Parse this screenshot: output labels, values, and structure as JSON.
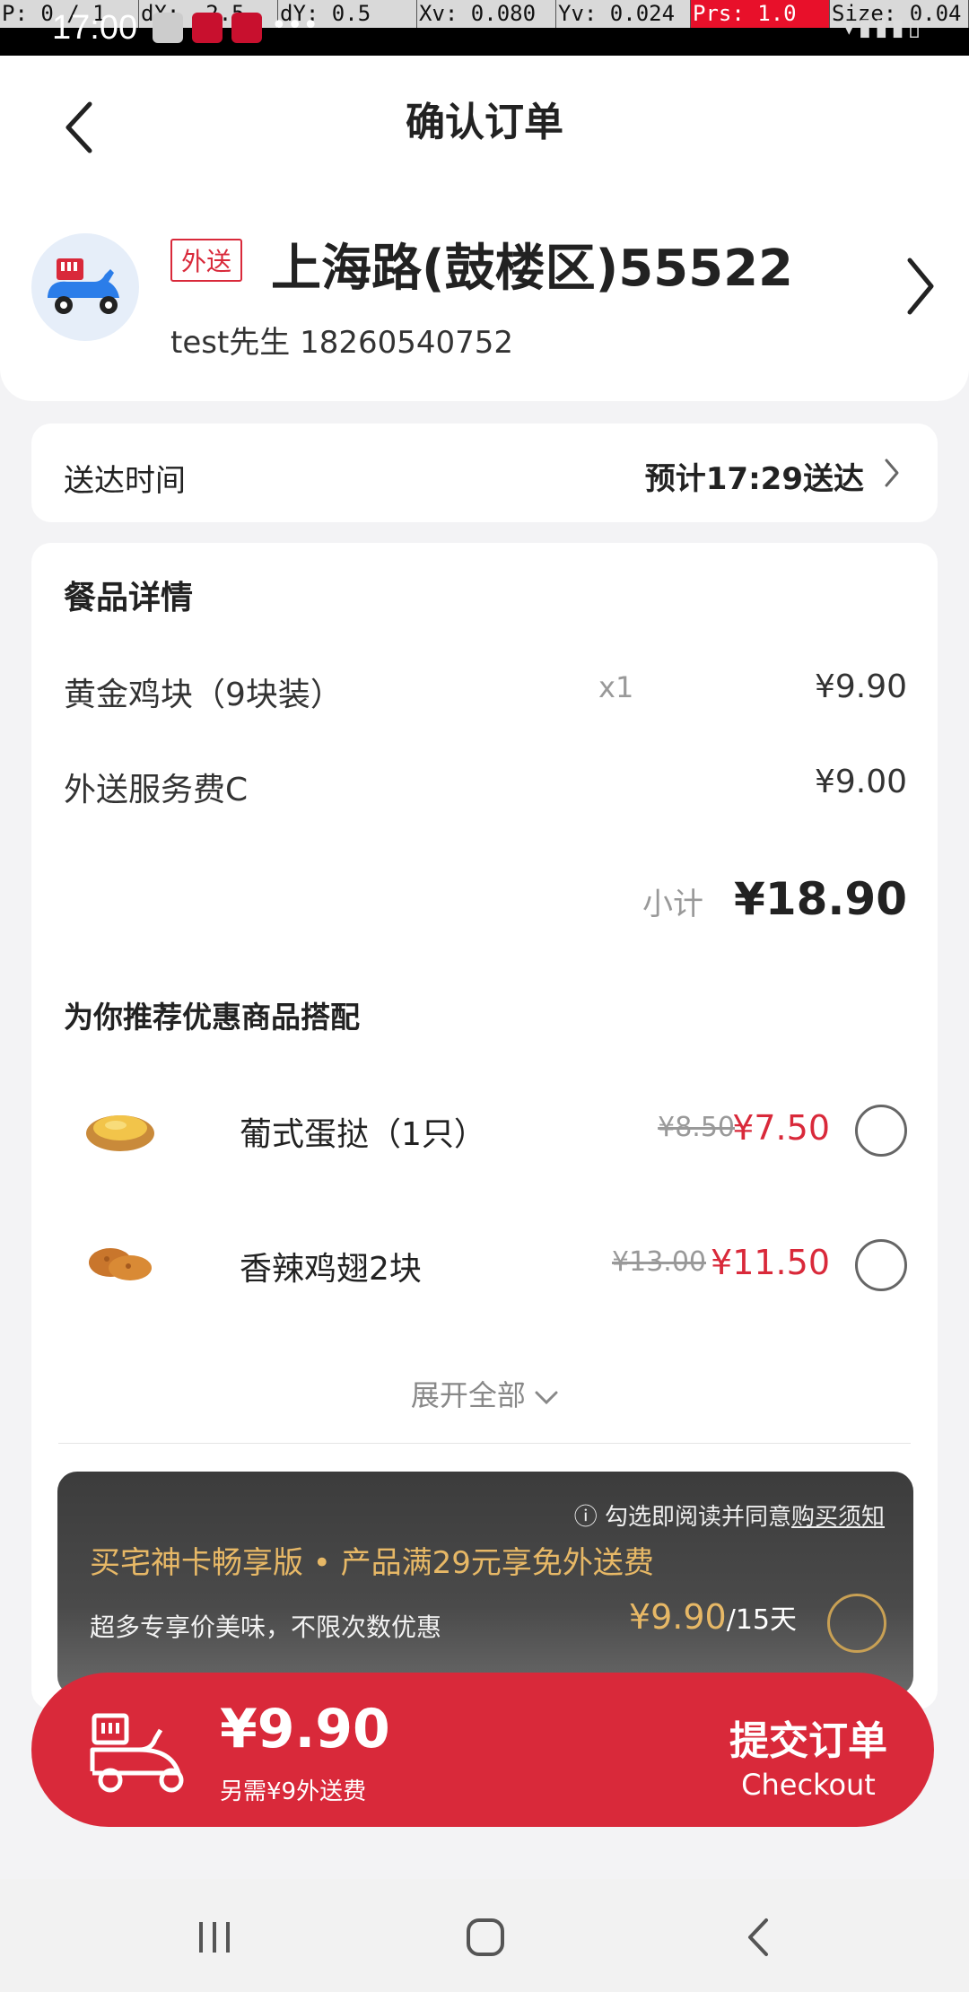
{
  "status_bar": {
    "debug": {
      "p": "P: 0 / 1",
      "dx": "dX: -2.5",
      "dy": "dY: 0.5",
      "xv": "Xv: 0.080",
      "yv": "Yv: 0.024",
      "prs": "Prs: 1.0",
      "size": "Size: 0.04"
    },
    "time": "17:00",
    "more": "•••"
  },
  "header": {
    "title": "确认订单"
  },
  "address": {
    "tag": "外送",
    "line": "上海路(鼓楼区)55522",
    "contact": "test先生  18260540752"
  },
  "delivery_time": {
    "label": "送达时间",
    "value": "预计17:29送达"
  },
  "order": {
    "section_title": "餐品详情",
    "items": [
      {
        "name": "黄金鸡块（9块装）",
        "qty": "x1",
        "price": "¥9.90"
      },
      {
        "name": "外送服务费C",
        "qty": "",
        "price": "¥9.00"
      }
    ],
    "subtotal_label": "小计",
    "subtotal_value": "¥18.90"
  },
  "recommend": {
    "title": "为你推荐优惠商品搭配",
    "items": [
      {
        "name": "葡式蛋挞（1只）",
        "old_price": "¥8.50",
        "new_price": "¥7.50",
        "image": "egg-tart"
      },
      {
        "name": "香辣鸡翅2块",
        "old_price": "¥13.00",
        "new_price": "¥11.50",
        "image": "chicken-wings"
      }
    ],
    "expand_label": "展开全部"
  },
  "membership": {
    "notice_prefix": "勾选即阅读并同意",
    "notice_link": "购买须知",
    "title": "买宅神卡畅享版 • 产品满29元享免外送费",
    "subtitle": "超多专享价美味，不限次数优惠",
    "price": "¥9.90",
    "period": "/15天"
  },
  "checkout": {
    "amount": "¥9.90",
    "note": "另需¥9外送费",
    "submit_cn": "提交订单",
    "submit_en": "Checkout"
  },
  "colors": {
    "brand_red": "#d9293a",
    "gold": "#e7b866"
  }
}
